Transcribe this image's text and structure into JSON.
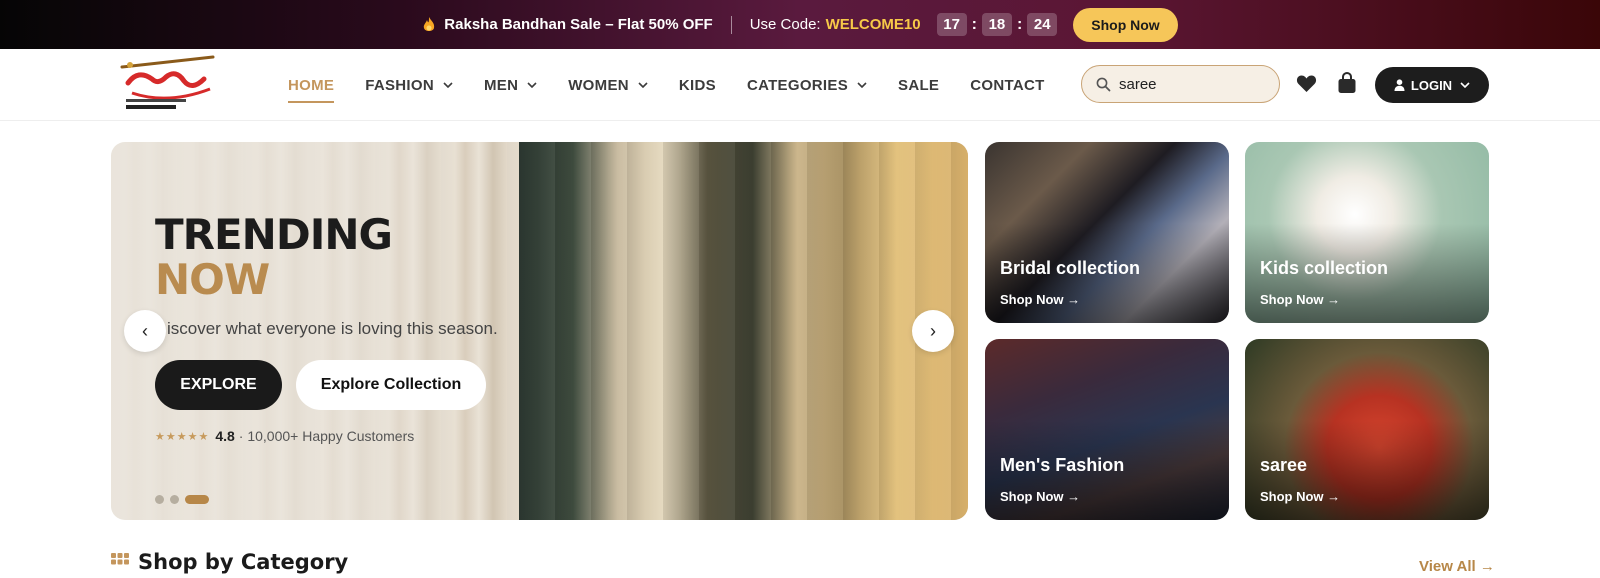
{
  "announcement": {
    "sale_text": "Raksha Bandhan Sale – Flat 50% OFF",
    "code_label": "Use Code:",
    "code": "WELCOME10",
    "timer": {
      "hours": "17",
      "minutes": "18",
      "seconds": "24"
    },
    "shop_now": "Shop Now"
  },
  "header": {
    "logo_alt": "Vandana Shopping Mall",
    "nav": [
      {
        "label": "HOME",
        "active": true
      },
      {
        "label": "FASHION",
        "dropdown": true
      },
      {
        "label": "MEN",
        "dropdown": true
      },
      {
        "label": "WOMEN",
        "dropdown": true
      },
      {
        "label": "KIDS"
      },
      {
        "label": "CATEGORIES",
        "dropdown": true
      },
      {
        "label": "SALE"
      },
      {
        "label": "CONTACT"
      }
    ],
    "search_value": "saree",
    "login_label": "LOGIN"
  },
  "hero": {
    "title_line1": "TRENDING",
    "title_line2": "NOW",
    "subtitle": "iscover what everyone is loving this season.",
    "explore_label": "EXPLORE",
    "collection_label": "Explore Collection",
    "rating_stars": "★★★★★",
    "rating_value": "4.8",
    "rating_text": "· 10,000+ Happy Customers",
    "prev_label": "‹",
    "next_label": "›",
    "active_slide": 3,
    "slide_count": 3
  },
  "promo_cards": [
    {
      "title": "Bridal collection",
      "cta": "Shop Now →"
    },
    {
      "title": "Kids collection",
      "cta": "Shop Now →"
    },
    {
      "title": "Men's Fashion",
      "cta": "Shop Now →"
    },
    {
      "title": "saree",
      "cta": "Shop Now →"
    }
  ],
  "categories": {
    "title": "Shop by Category",
    "view_all": "View All →"
  },
  "colors": {
    "accent": "#c4965d",
    "code": "#f7c948",
    "dark": "#1d1d1d"
  }
}
